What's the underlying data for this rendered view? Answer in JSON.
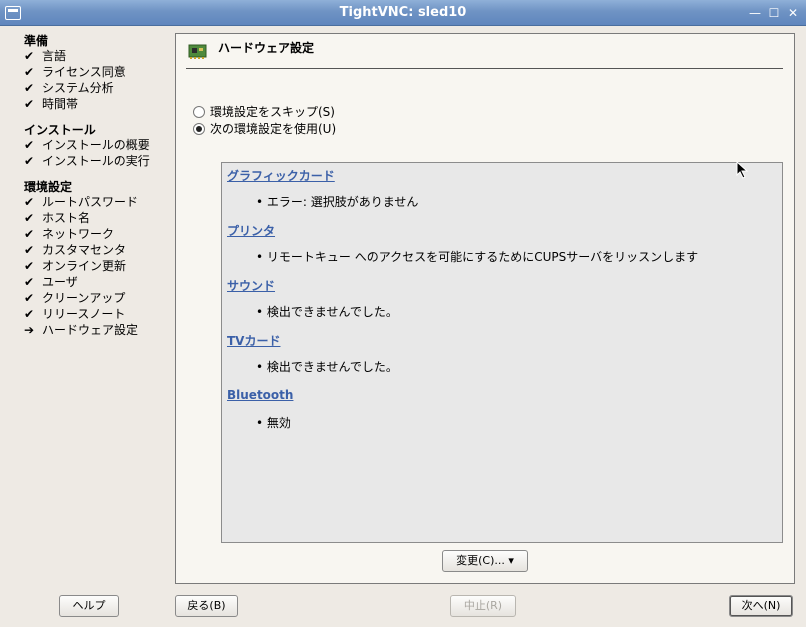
{
  "window": {
    "title": "TightVNC: sled10"
  },
  "sidebar": {
    "groups": [
      {
        "title": "準備",
        "items": [
          {
            "label": "言語",
            "state": "done"
          },
          {
            "label": "ライセンス同意",
            "state": "done"
          },
          {
            "label": "システム分析",
            "state": "done"
          },
          {
            "label": "時間帯",
            "state": "done"
          }
        ]
      },
      {
        "title": "インストール",
        "items": [
          {
            "label": "インストールの概要",
            "state": "done"
          },
          {
            "label": "インストールの実行",
            "state": "done"
          }
        ]
      },
      {
        "title": "環境設定",
        "items": [
          {
            "label": "ルートパスワード",
            "state": "done"
          },
          {
            "label": "ホスト名",
            "state": "done"
          },
          {
            "label": "ネットワーク",
            "state": "done"
          },
          {
            "label": "カスタマセンタ",
            "state": "done"
          },
          {
            "label": "オンライン更新",
            "state": "done"
          },
          {
            "label": "ユーザ",
            "state": "done"
          },
          {
            "label": "クリーンアップ",
            "state": "done"
          },
          {
            "label": "リリースノート",
            "state": "done"
          },
          {
            "label": "ハードウェア設定",
            "state": "current"
          }
        ]
      }
    ]
  },
  "glyphs": {
    "done": "✔",
    "current": "➔"
  },
  "panel": {
    "title": "ハードウェア設定",
    "options": [
      {
        "label": "環境設定をスキップ(S)",
        "selected": false
      },
      {
        "label": "次の環境設定を使用(U)",
        "selected": true
      }
    ],
    "sections": [
      {
        "title": "グラフィックカード",
        "item": "• エラー: 選択肢がありません"
      },
      {
        "title": "プリンタ",
        "item": "• リモートキュー へのアクセスを可能にするためにCUPSサーバをリッスンします"
      },
      {
        "title": "サウンド",
        "item": "• 検出できませんでした。"
      },
      {
        "title": "TVカード",
        "item": "• 検出できませんでした。"
      },
      {
        "title": "Bluetooth",
        "item": "• 無効"
      }
    ],
    "change_button": "変更(C)... ▾"
  },
  "footer": {
    "help": "ヘルプ",
    "back": "戻る(B)",
    "abort": "中止(R)",
    "next": "次へ(N)"
  },
  "colors": {
    "titlebar": "#6f93c4",
    "link": "#3b60a8"
  }
}
